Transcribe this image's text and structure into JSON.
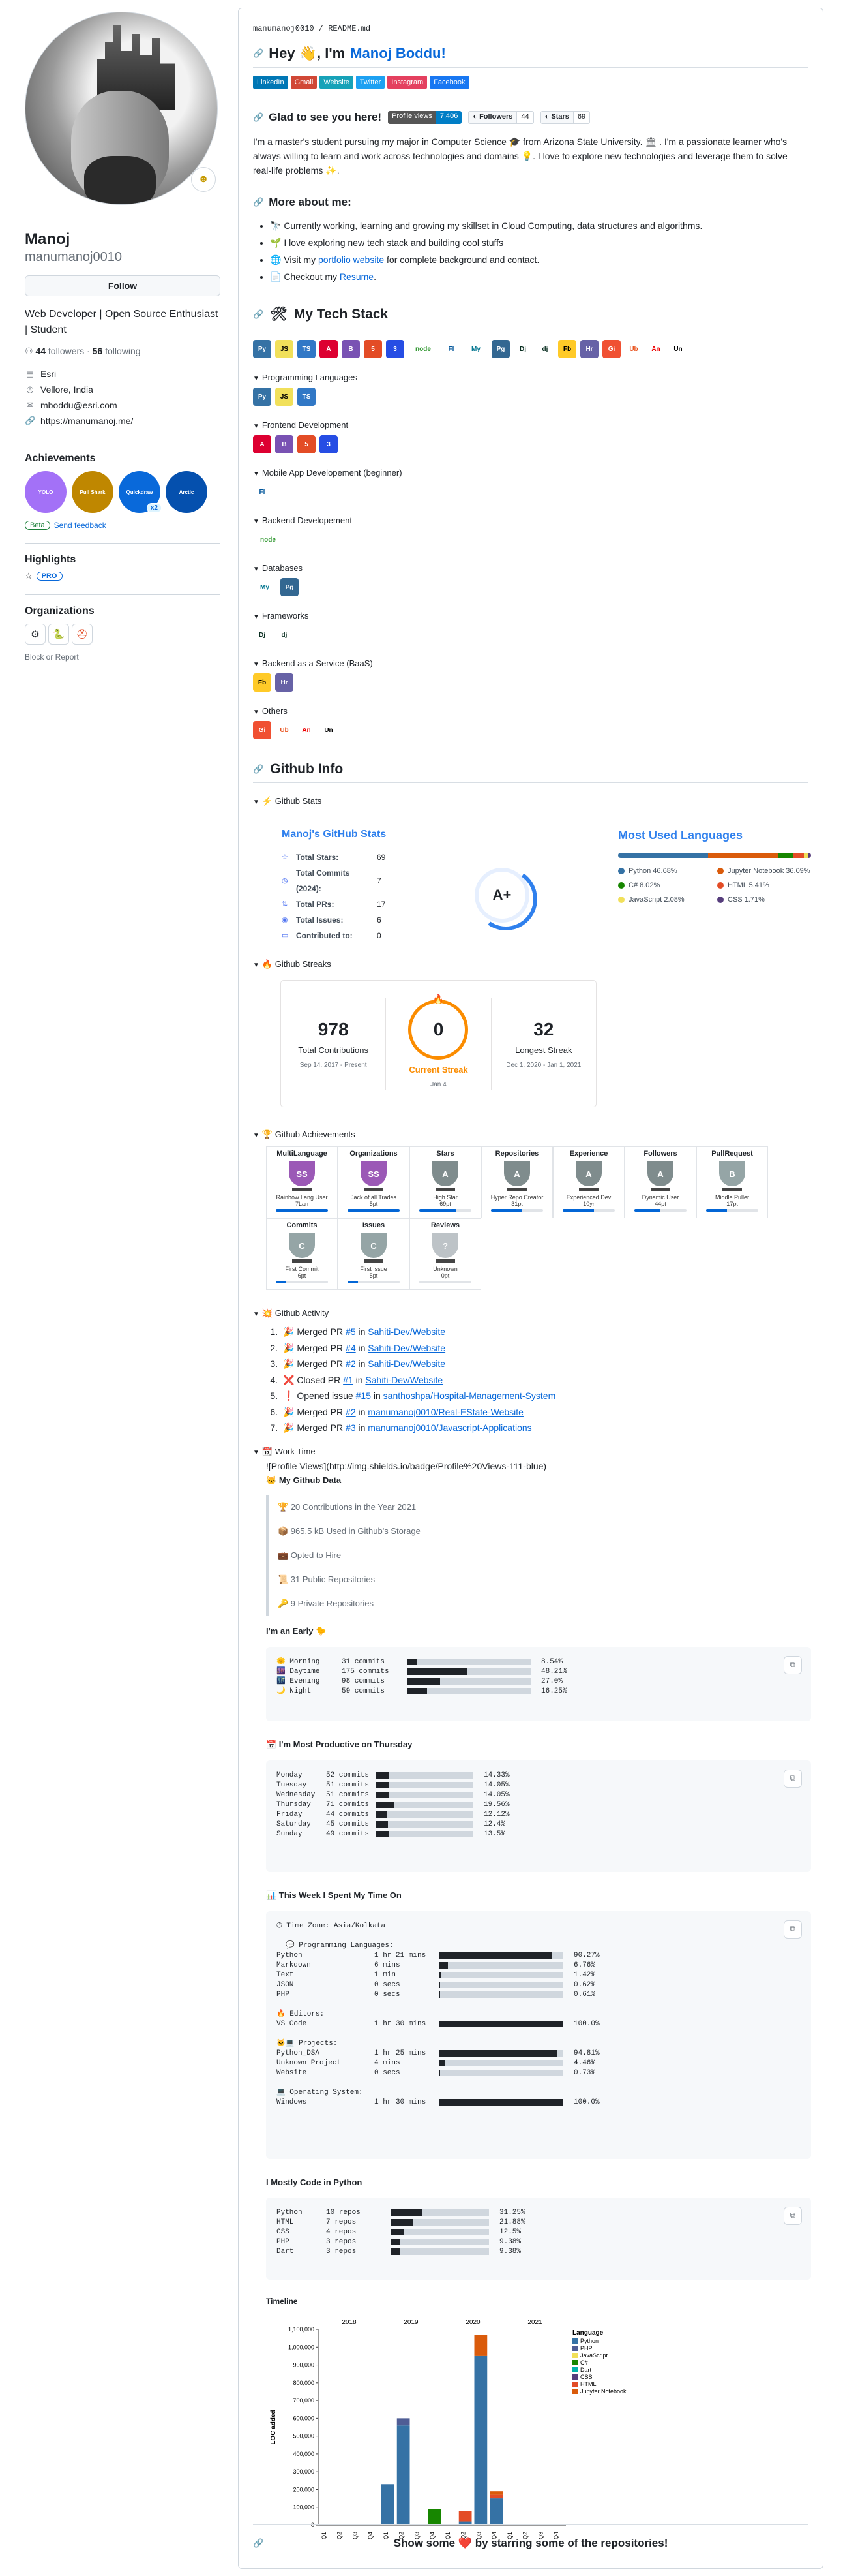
{
  "profile": {
    "name": "Manoj",
    "login": "manumanoj0010",
    "follow_label": "Follow",
    "bio": "Web Developer | Open Source Enthusiast | Student",
    "followers": "44",
    "followers_label": "followers",
    "following": "56",
    "following_label": "following",
    "company": "Esri",
    "location": "Vellore, India",
    "email": "mboddu@esri.com",
    "website": "https://manumanoj.me/",
    "achievements_title": "Achievements",
    "achievement_badges": [
      {
        "name": "YOLO",
        "count": "",
        "color": "#a371f7"
      },
      {
        "name": "Pull Shark",
        "count": "",
        "color": "#bf8700"
      },
      {
        "name": "Quickdraw",
        "count": "x2",
        "color": "#0969da"
      },
      {
        "name": "Arctic",
        "count": "",
        "color": "#0550ae"
      }
    ],
    "beta_label": "Beta",
    "feedback_label": "Send feedback",
    "highlights_title": "Highlights",
    "pro_label": "PRO",
    "orgs_title": "Organizations",
    "block_label": "Block or Report"
  },
  "readme": {
    "crumb": "manumanoj0010 / README.md",
    "hey": "Hey 👋, I'm",
    "hey_name": "Manoj Boddu!",
    "social": [
      {
        "label": "LinkedIn",
        "color": "#0077b5"
      },
      {
        "label": "Gmail",
        "color": "#d14836"
      },
      {
        "label": "Website",
        "color": "#17a2b8"
      },
      {
        "label": "Twitter",
        "color": "#1da1f2"
      },
      {
        "label": "Instagram",
        "color": "#e4405f"
      },
      {
        "label": "Facebook",
        "color": "#1877f2"
      }
    ],
    "glad": "Glad to see you here!",
    "profile_views_label": "Profile views",
    "profile_views_value": "7,406",
    "followers_badge_label": "Followers",
    "followers_badge_value": "44",
    "stars_badge_label": "Stars",
    "stars_badge_value": "69",
    "intro": "I'm a master's student pursuing my major in Computer Science 🎓 from Arizona State University. 🏛 . I'm a passionate learner who's always willing to learn and work across technologies and domains 💡. I love to explore new technologies and leverage them to solve real-life problems ✨.",
    "more_title": "More about me:",
    "more_items": [
      "🔭 Currently working, learning and growing my skillset in Cloud Computing, data structures and algorithms.",
      "🌱 I love exploring new tech stack and building cool stuffs",
      "🌐 Visit my",
      "📄 Checkout my"
    ],
    "portfolio_link": "portfolio website",
    "portfolio_rest": "for complete background and contact.",
    "resume_link": "Resume",
    "tech_title": "My Tech Stack",
    "tech_icons": [
      "Py",
      "JS",
      "TS",
      "A",
      "B",
      "5",
      "3",
      "node",
      "Fl",
      "My",
      "Pg",
      "Dj",
      "dj",
      "Fb",
      "Hr",
      "Gi",
      "Ub",
      "An",
      "Un"
    ],
    "groups": [
      {
        "title": "Programming Languages",
        "icons": [
          "Py",
          "JS",
          "TS"
        ]
      },
      {
        "title": "Frontend Development",
        "icons": [
          "A",
          "B",
          "5",
          "3"
        ]
      },
      {
        "title": "Mobile App Developement (beginner)",
        "icons": [
          "Fl"
        ]
      },
      {
        "title": "Backend Developement",
        "icons": [
          "node"
        ]
      },
      {
        "title": "Databases",
        "icons": [
          "My",
          "Pg"
        ]
      },
      {
        "title": "Frameworks",
        "icons": [
          "Dj",
          "dj"
        ]
      },
      {
        "title": "Backend as a Service (BaaS)",
        "icons": [
          "Fb",
          "Hr"
        ]
      },
      {
        "title": "Others",
        "icons": [
          "Gi",
          "Ub",
          "An",
          "Un"
        ]
      }
    ],
    "github_info_title": "Github Info",
    "stats_title": "Github Stats",
    "stats_card_title": "Manoj's GitHub Stats",
    "stats": [
      {
        "label": "Total Stars:",
        "value": "69",
        "icon": "☆"
      },
      {
        "label": "Total Commits (2024):",
        "value": "7",
        "icon": "◷"
      },
      {
        "label": "Total PRs:",
        "value": "17",
        "icon": "⇅"
      },
      {
        "label": "Total Issues:",
        "value": "6",
        "icon": "◉"
      },
      {
        "label": "Contributed to:",
        "value": "0",
        "icon": "▭"
      }
    ],
    "rank": "A+",
    "lang_title": "Most Used Languages",
    "langs": [
      {
        "name": "Python",
        "pct": 46.68,
        "label": "Python 46.68%",
        "color": "#3572A5"
      },
      {
        "name": "Jupyter Notebook",
        "pct": 36.09,
        "label": "Jupyter Notebook 36.09%",
        "color": "#DA5B0B"
      },
      {
        "name": "C#",
        "pct": 8.02,
        "label": "C# 8.02%",
        "color": "#178600"
      },
      {
        "name": "HTML",
        "pct": 5.41,
        "label": "HTML 5.41%",
        "color": "#e34c26"
      },
      {
        "name": "JavaScript",
        "pct": 2.08,
        "label": "JavaScript 2.08%",
        "color": "#f1e05a"
      },
      {
        "name": "CSS",
        "pct": 1.71,
        "label": "CSS 1.71%",
        "color": "#563d7c"
      }
    ],
    "streaks_title": "Github Streaks",
    "streak": {
      "total": "978",
      "total_label": "Total Contributions",
      "total_range": "Sep 14, 2017 - Present",
      "current": "0",
      "current_label": "Current Streak",
      "current_date": "Jan 4",
      "longest": "32",
      "longest_label": "Longest Streak",
      "longest_range": "Dec 1, 2020 - Jan 1, 2021"
    },
    "achievements_title": "Github Achievements",
    "trophies": [
      {
        "title": "MultiLanguage",
        "rank": "SS",
        "l1": "Rainbow Lang User",
        "l2": "7Lan",
        "color": "#9b59b6",
        "p": 100
      },
      {
        "title": "Organizations",
        "rank": "SS",
        "l1": "Jack of all Trades",
        "l2": "5pt",
        "color": "#9b59b6",
        "p": 100
      },
      {
        "title": "Stars",
        "rank": "A",
        "l1": "High Star",
        "l2": "69pt",
        "color": "#7f8c8d",
        "p": 70
      },
      {
        "title": "Repositories",
        "rank": "A",
        "l1": "Hyper Repo Creator",
        "l2": "31pt",
        "color": "#7f8c8d",
        "p": 60
      },
      {
        "title": "Experience",
        "rank": "A",
        "l1": "Experienced Dev",
        "l2": "10yr",
        "color": "#7f8c8d",
        "p": 60
      },
      {
        "title": "Followers",
        "rank": "A",
        "l1": "Dynamic User",
        "l2": "44pt",
        "color": "#7f8c8d",
        "p": 50
      },
      {
        "title": "PullRequest",
        "rank": "B",
        "l1": "Middle Puller",
        "l2": "17pt",
        "color": "#95a5a6",
        "p": 40
      },
      {
        "title": "Commits",
        "rank": "C",
        "l1": "First Commit",
        "l2": "6pt",
        "color": "#95a5a6",
        "p": 20
      },
      {
        "title": "Issues",
        "rank": "C",
        "l1": "First Issue",
        "l2": "5pt",
        "color": "#95a5a6",
        "p": 20
      },
      {
        "title": "Reviews",
        "rank": "?",
        "l1": "Unknown",
        "l2": "0pt",
        "color": "#bdc3c7",
        "p": 0
      }
    ],
    "activity_title": "Github Activity",
    "activity": [
      {
        "icon": "🎉",
        "text": "Merged PR",
        "pr": "#5",
        "in": "in",
        "repo": "Sahiti-Dev/Website"
      },
      {
        "icon": "🎉",
        "text": "Merged PR",
        "pr": "#4",
        "in": "in",
        "repo": "Sahiti-Dev/Website"
      },
      {
        "icon": "🎉",
        "text": "Merged PR",
        "pr": "#2",
        "in": "in",
        "repo": "Sahiti-Dev/Website"
      },
      {
        "icon": "❌",
        "text": "Closed PR",
        "pr": "#1",
        "in": "in",
        "repo": "Sahiti-Dev/Website"
      },
      {
        "icon": "❗",
        "text": "Opened issue",
        "pr": "#15",
        "in": "in",
        "repo": "santhoshpa/Hospital-Management-System"
      },
      {
        "icon": "🎉",
        "text": "Merged PR",
        "pr": "#2",
        "in": "in",
        "repo": "manumanoj0010/Real-EState-Website"
      },
      {
        "icon": "🎉",
        "text": "Merged PR",
        "pr": "#3",
        "in": "in",
        "repo": "manumanoj0010/Javascript-Applications"
      }
    ],
    "work_time_title": "Work Time",
    "work_time_line": "![Profile Views](http://img.shields.io/badge/Profile%20Views-111-blue)",
    "gdata_title": "My Github Data",
    "gdata": [
      "🏆 20 Contributions in the Year 2021",
      "📦 965.5 kB Used in Github's Storage",
      "💼 Opted to Hire",
      "📜 31 Public Repositories",
      "🔑 9 Private Repositories"
    ],
    "early_title": "I'm an Early 🐤",
    "early": [
      {
        "label": "🌞 Morning",
        "commits": "31 commits",
        "pct": 8.54,
        "pct_label": "8.54%"
      },
      {
        "label": "🌆 Daytime",
        "commits": "175 commits",
        "pct": 48.21,
        "pct_label": "48.21%"
      },
      {
        "label": "🌃 Evening",
        "commits": "98 commits",
        "pct": 27.0,
        "pct_label": "27.0%"
      },
      {
        "label": "🌙 Night",
        "commits": "59 commits",
        "pct": 16.25,
        "pct_label": "16.25%"
      }
    ],
    "productive_title": "📅 I'm Most Productive on Thursday",
    "week": [
      {
        "label": "Monday",
        "commits": "52 commits",
        "pct": 14.33,
        "pct_label": "14.33%"
      },
      {
        "label": "Tuesday",
        "commits": "51 commits",
        "pct": 14.05,
        "pct_label": "14.05%"
      },
      {
        "label": "Wednesday",
        "commits": "51 commits",
        "pct": 14.05,
        "pct_label": "14.05%"
      },
      {
        "label": "Thursday",
        "commits": "71 commits",
        "pct": 19.56,
        "pct_label": "19.56%"
      },
      {
        "label": "Friday",
        "commits": "44 commits",
        "pct": 12.12,
        "pct_label": "12.12%"
      },
      {
        "label": "Saturday",
        "commits": "45 commits",
        "pct": 12.4,
        "pct_label": "12.4%"
      },
      {
        "label": "Sunday",
        "commits": "49 commits",
        "pct": 13.5,
        "pct_label": "13.5%"
      }
    ],
    "week_time_title": "📊 This Week I Spent My Time On",
    "tz": "🕑︎ Time Zone: Asia/Kolkata",
    "prog_lang_head": "💬 Programming Languages:",
    "prog_langs": [
      {
        "label": "Python",
        "time": "1 hr 21 mins",
        "pct": 90.27,
        "pct_label": "90.27%"
      },
      {
        "label": "Markdown",
        "time": "6 mins",
        "pct": 6.76,
        "pct_label": "6.76%"
      },
      {
        "label": "Text",
        "time": "1 min",
        "pct": 1.42,
        "pct_label": "1.42%"
      },
      {
        "label": "JSON",
        "time": "0 secs",
        "pct": 0.62,
        "pct_label": "0.62%"
      },
      {
        "label": "PHP",
        "time": "0 secs",
        "pct": 0.61,
        "pct_label": "0.61%"
      }
    ],
    "editors_head": "🔥 Editors:",
    "editors": [
      {
        "label": "VS Code",
        "time": "1 hr 30 mins",
        "pct": 100.0,
        "pct_label": "100.0%"
      }
    ],
    "projects_head": "🐱‍💻 Projects:",
    "projects": [
      {
        "label": "Python_DSA",
        "time": "1 hr 25 mins",
        "pct": 94.81,
        "pct_label": "94.81%"
      },
      {
        "label": "Unknown Project",
        "time": "4 mins",
        "pct": 4.46,
        "pct_label": "4.46%"
      },
      {
        "label": "Website",
        "time": "0 secs",
        "pct": 0.73,
        "pct_label": "0.73%"
      }
    ],
    "os_head": "💻 Operating System:",
    "os": [
      {
        "label": "Windows",
        "time": "1 hr 30 mins",
        "pct": 100.0,
        "pct_label": "100.0%"
      }
    ],
    "code_python_title": "I Mostly Code in Python",
    "repos": [
      {
        "label": "Python",
        "commits": "10 repos",
        "pct": 31.25,
        "pct_label": "31.25%"
      },
      {
        "label": "HTML",
        "commits": "7 repos",
        "pct": 21.88,
        "pct_label": "21.88%"
      },
      {
        "label": "CSS",
        "commits": "4 repos",
        "pct": 12.5,
        "pct_label": "12.5%"
      },
      {
        "label": "PHP",
        "commits": "3 repos",
        "pct": 9.38,
        "pct_label": "9.38%"
      },
      {
        "label": "Dart",
        "commits": "3 repos",
        "pct": 9.38,
        "pct_label": "9.38%"
      }
    ],
    "timeline_title": "Timeline",
    "footer": "Show some ❤️ by starring some of the repositories!"
  },
  "chart_data": {
    "type": "bar",
    "stacked": true,
    "title": "",
    "ylabel": "LOC added",
    "xlabel": "",
    "ylim": [
      0,
      1100000
    ],
    "yticks": [
      0,
      100000,
      200000,
      300000,
      400000,
      500000,
      600000,
      700000,
      800000,
      900000,
      1000000,
      1100000
    ],
    "ytick_labels": [
      "0",
      "100,000",
      "200,000",
      "300,000",
      "400,000",
      "500,000",
      "600,000",
      "700,000",
      "800,000",
      "900,000",
      "1,000,000",
      "1,100,000"
    ],
    "years": [
      "2018",
      "2019",
      "2020",
      "2021"
    ],
    "categories": [
      "Q1",
      "Q2",
      "Q3",
      "Q4",
      "Q1",
      "Q2",
      "Q3",
      "Q4",
      "Q1",
      "Q2",
      "Q3",
      "Q4",
      "Q1",
      "Q2",
      "Q3",
      "Q4"
    ],
    "legend_title": "Language",
    "legend_placement": "right",
    "series": [
      {
        "name": "Python",
        "color": "#3572A5",
        "values": [
          0,
          0,
          0,
          0,
          230000,
          560000,
          0,
          0,
          0,
          20000,
          950000,
          150000,
          0,
          0,
          0,
          0
        ]
      },
      {
        "name": "PHP",
        "color": "#4F5D95",
        "values": [
          0,
          0,
          0,
          0,
          0,
          40000,
          0,
          0,
          0,
          0,
          0,
          0,
          0,
          0,
          0,
          0
        ]
      },
      {
        "name": "JavaScript",
        "color": "#f1e05a",
        "values": [
          0,
          0,
          0,
          0,
          0,
          0,
          0,
          0,
          0,
          0,
          0,
          0,
          0,
          0,
          0,
          0
        ]
      },
      {
        "name": "C#",
        "color": "#178600",
        "values": [
          0,
          0,
          0,
          0,
          0,
          0,
          0,
          90000,
          0,
          0,
          0,
          0,
          0,
          0,
          0,
          0
        ]
      },
      {
        "name": "Dart",
        "color": "#00B4AB",
        "values": [
          0,
          0,
          0,
          0,
          0,
          0,
          0,
          0,
          0,
          0,
          0,
          0,
          0,
          0,
          0,
          0
        ]
      },
      {
        "name": "CSS",
        "color": "#563d7c",
        "values": [
          0,
          0,
          0,
          0,
          0,
          0,
          0,
          0,
          0,
          0,
          0,
          0,
          0,
          0,
          0,
          0
        ]
      },
      {
        "name": "HTML",
        "color": "#e34c26",
        "values": [
          0,
          0,
          0,
          0,
          0,
          0,
          0,
          0,
          0,
          60000,
          0,
          20000,
          0,
          0,
          0,
          0
        ]
      },
      {
        "name": "Jupyter Notebook",
        "color": "#DA5B0B",
        "values": [
          0,
          0,
          0,
          0,
          0,
          0,
          0,
          0,
          0,
          0,
          120000,
          20000,
          0,
          0,
          0,
          0
        ]
      }
    ]
  }
}
